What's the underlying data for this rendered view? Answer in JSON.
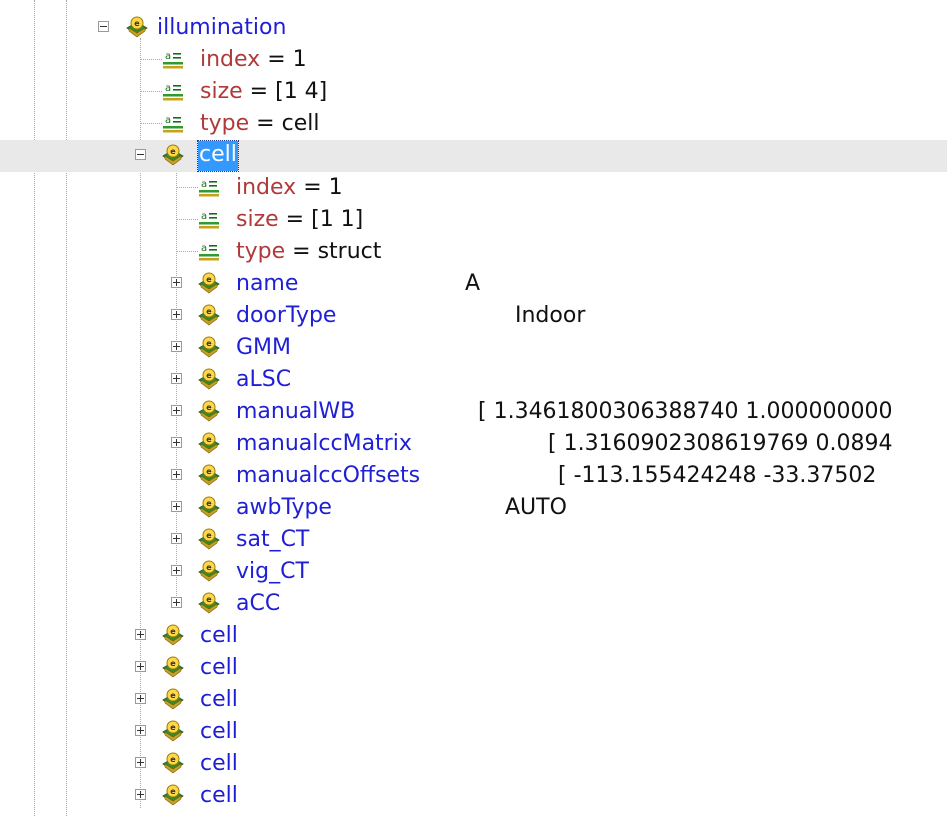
{
  "root": {
    "label": "illumination",
    "fields": [
      {
        "key": "index",
        "value": "1"
      },
      {
        "key": "size",
        "value": "[1 4]"
      },
      {
        "key": "type",
        "value": "cell"
      }
    ],
    "selected_cell": {
      "label": "cell",
      "fields": [
        {
          "key": "index",
          "value": "1"
        },
        {
          "key": "size",
          "value": "[1 1]"
        },
        {
          "key": "type",
          "value": "struct"
        }
      ],
      "children": [
        {
          "label": "name",
          "value": "A"
        },
        {
          "label": "doorType",
          "value": "Indoor"
        },
        {
          "label": "GMM",
          "value": ""
        },
        {
          "label": "aLSC",
          "value": ""
        },
        {
          "label": "manualWB",
          "value": "[ 1.3461800306388740 1.000000000"
        },
        {
          "label": "manualccMatrix",
          "value": "[ 1.3160902308619769 0.0894"
        },
        {
          "label": "manualccOffsets",
          "value": "[ -113.155424248 -33.37502"
        },
        {
          "label": "awbType",
          "value": "AUTO"
        },
        {
          "label": "sat_CT",
          "value": ""
        },
        {
          "label": "vig_CT",
          "value": ""
        },
        {
          "label": "aCC",
          "value": ""
        }
      ]
    },
    "collapsed_cells": [
      "cell",
      "cell",
      "cell",
      "cell",
      "cell",
      "cell"
    ]
  },
  "symbols": {
    "equals": "="
  },
  "icons": {
    "struct": "struct-node-icon",
    "attribute": "attribute-icon",
    "expand": "expand-toggle",
    "collapse": "collapse-toggle"
  },
  "colors": {
    "struct_label": "#1f1fd6",
    "attribute_key": "#b03a3a",
    "selection": "#3399ff",
    "selected_row_bg": "#e9e9e9"
  }
}
